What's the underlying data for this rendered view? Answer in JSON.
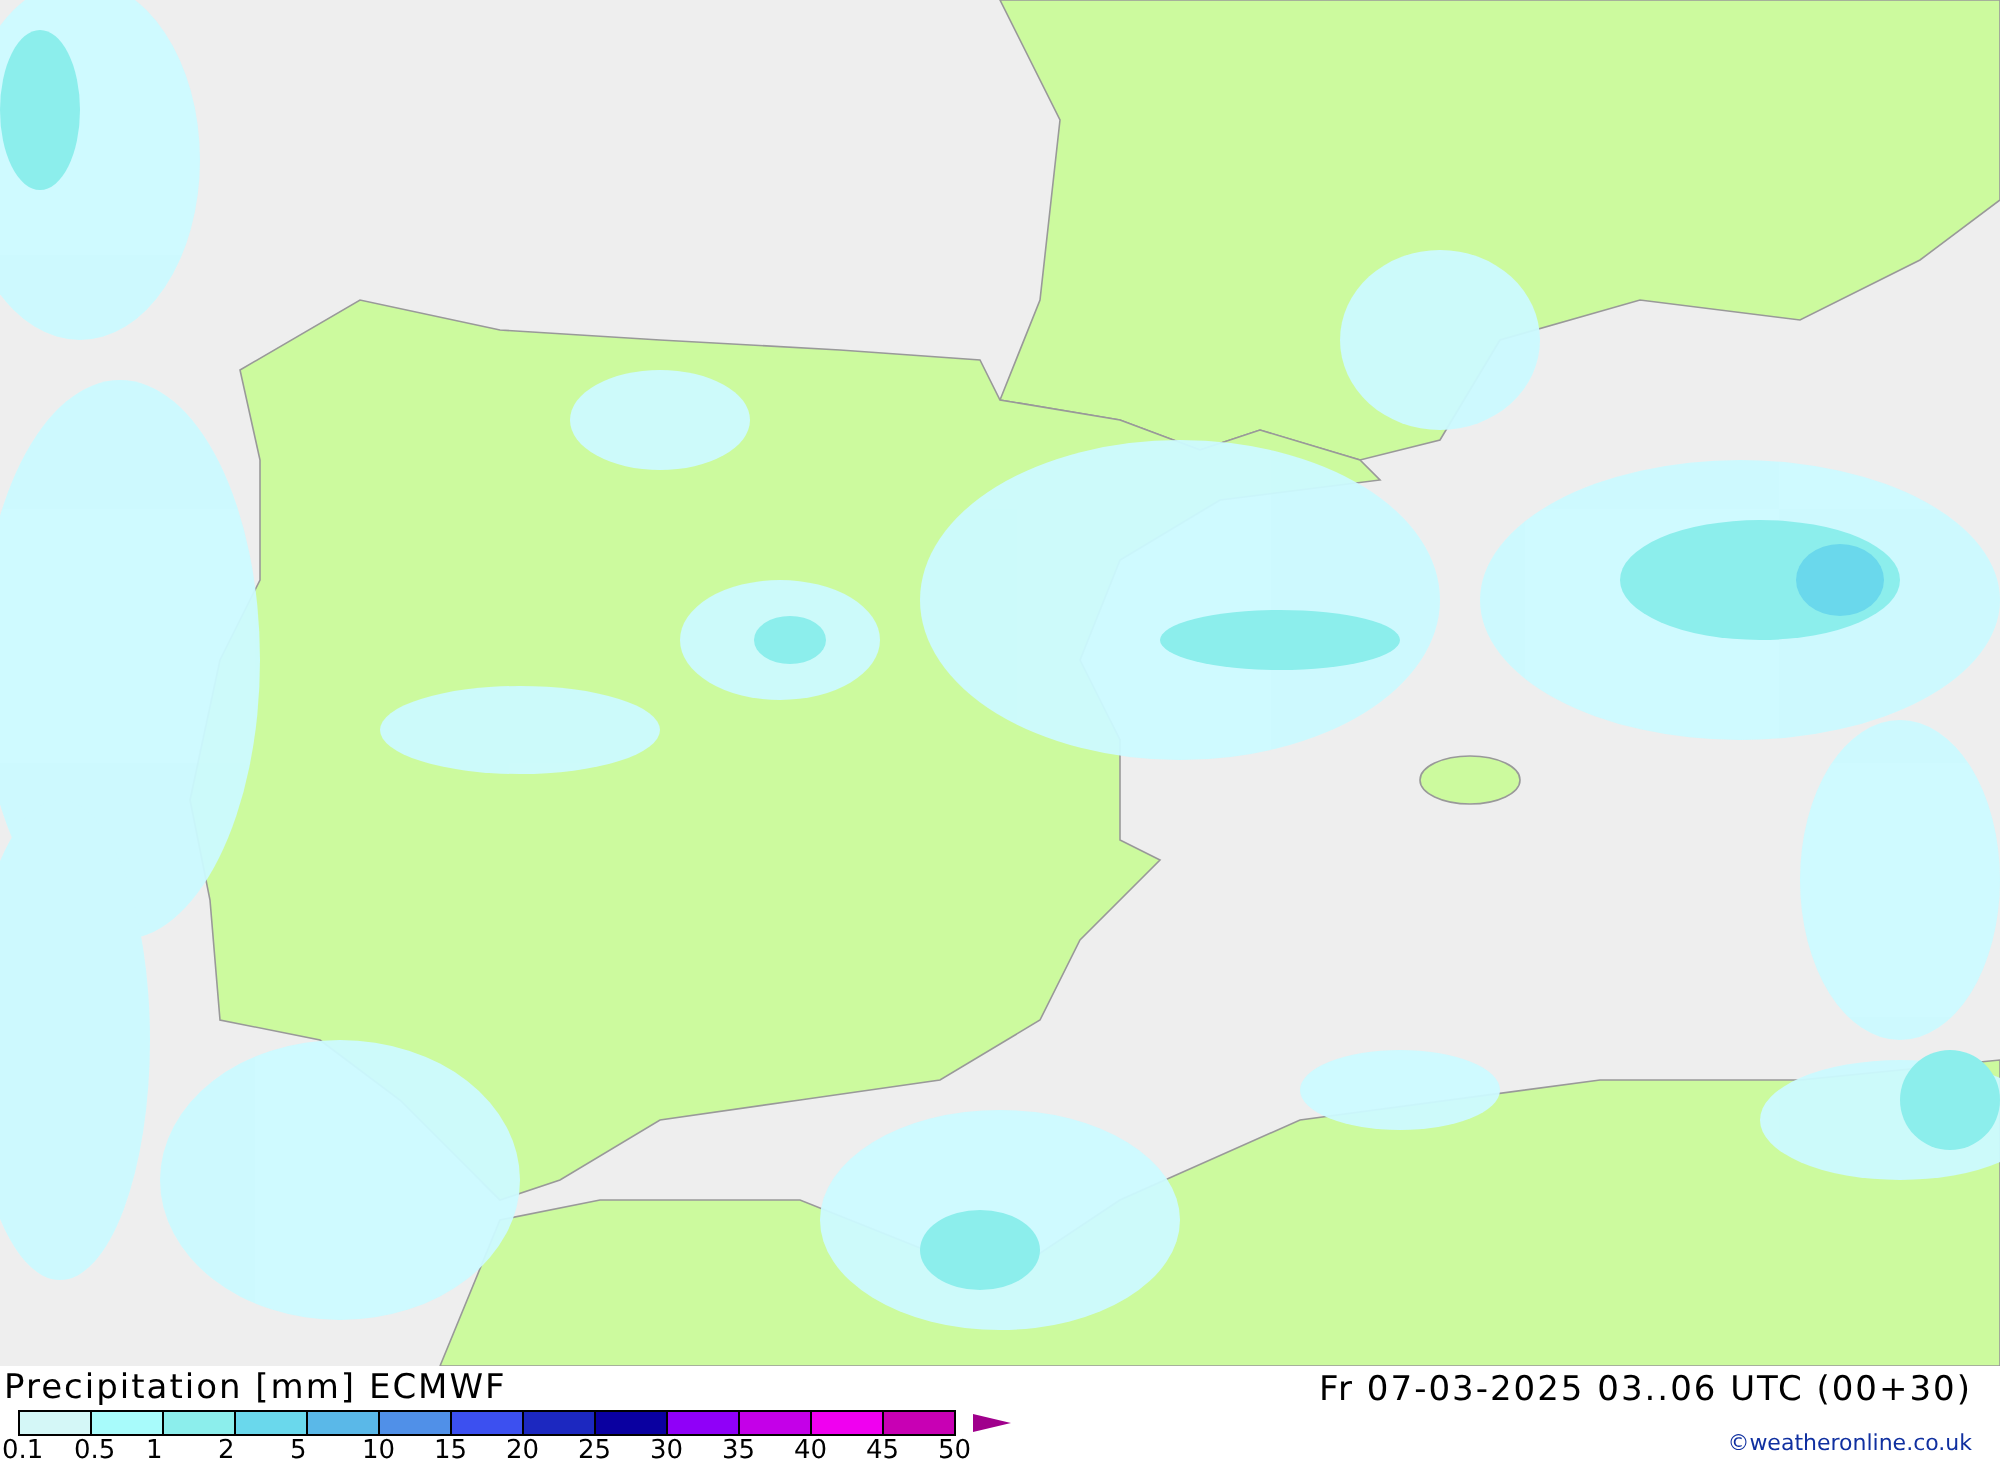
{
  "title": "Precipitation [mm] ECMWF",
  "valid_time": "Fr 07-03-2025 03..06 UTC (00+30)",
  "legend": {
    "bins": [
      {
        "color": "#d4f7f7"
      },
      {
        "color": "#a8fbfb"
      },
      {
        "color": "#8ceeec"
      },
      {
        "color": "#6ad8ec"
      },
      {
        "color": "#5ab8e8"
      },
      {
        "color": "#5090e8"
      },
      {
        "color": "#3c50f0"
      },
      {
        "color": "#1c28c0"
      },
      {
        "color": "#0a00a0"
      },
      {
        "color": "#9000f8"
      },
      {
        "color": "#c400e8"
      },
      {
        "color": "#f000f0"
      },
      {
        "color": "#c800b4"
      }
    ],
    "arrow": {
      "color": "#a0008c"
    },
    "ticks": [
      "0.1",
      "0.5",
      "1",
      "2",
      "5",
      "10",
      "15",
      "20",
      "25",
      "30",
      "35",
      "40",
      "45",
      "50"
    ]
  },
  "credit": "©weatheronline.co.uk"
}
